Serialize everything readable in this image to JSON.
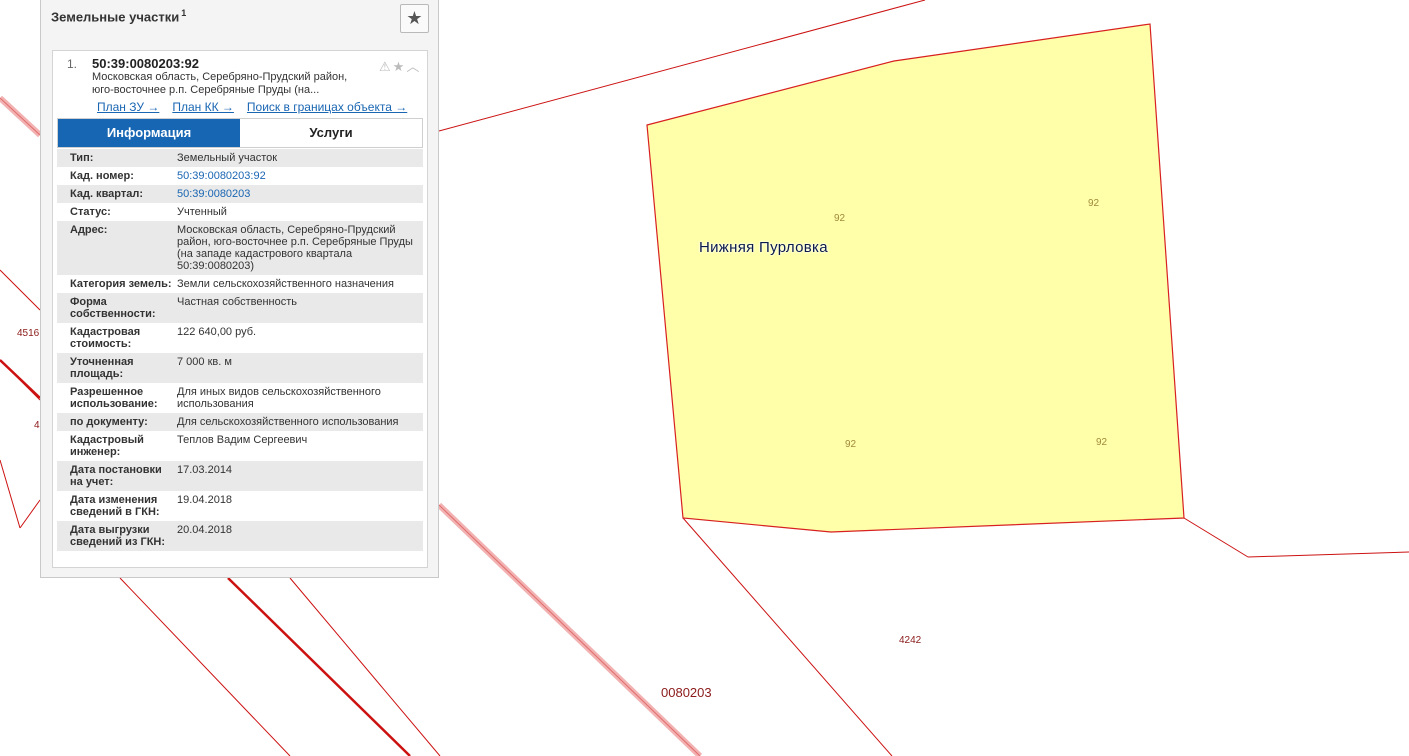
{
  "panel": {
    "title": "Земельные участки",
    "title_count": "1",
    "favorite_icon": "star-icon"
  },
  "result": {
    "index": "1.",
    "cad_number": "50:39:0080203:92",
    "address_short_1": "Московская область, Серебряно-Прудский район,",
    "address_short_2": "юго-восточнее р.п. Серебряные Пруды (на...",
    "icons": [
      "warning-icon",
      "star-icon",
      "chevron-up-icon"
    ],
    "links": {
      "plan_zu": "План ЗУ →",
      "plan_kk": "План КК →",
      "search_bounds": "Поиск в границах объекта →"
    }
  },
  "tabs": {
    "info": "Информация",
    "services": "Услуги"
  },
  "details": [
    {
      "label": "Тип:",
      "value": "Земельный участок"
    },
    {
      "label": "Кад. номер:",
      "value": "50:39:0080203:92"
    },
    {
      "label": "Кад. квартал:",
      "value": "50:39:0080203"
    },
    {
      "label": "Статус:",
      "value": "Учтенный"
    },
    {
      "label": "Адрес:",
      "value": "Московская область, Серебряно-Прудский район, юго-восточнее р.п. Серебряные Пруды (на западе кадастрового квартала 50:39:0080203)"
    },
    {
      "label": "Категория земель:",
      "value": "Земли сельскохозяйственного назначения"
    },
    {
      "label": "Форма собственности:",
      "value": "Частная собственность"
    },
    {
      "label": "Кадастровая стоимость:",
      "value": "122 640,00 руб."
    },
    {
      "label": "Уточненная площадь:",
      "value": "7 000 кв. м"
    },
    {
      "label": "Разрешенное использование:",
      "value": "Для иных видов сельскохозяйственного использования"
    },
    {
      "label": "по документу:",
      "value": "Для сельскохозяйственного использования"
    },
    {
      "label": "Кадастровый инженер:",
      "value": "Теплов Вадим Сергеевич"
    },
    {
      "label": "Дата постановки на учет:",
      "value": "17.03.2014"
    },
    {
      "label": "Дата изменения сведений в ГКН:",
      "value": "19.04.2018"
    },
    {
      "label": "Дата выгрузки сведений из ГКН:",
      "value": "20.04.2018"
    }
  ],
  "map": {
    "place_name": "Нижняя Пурловка",
    "plot_labels": [
      "92",
      "92",
      "92",
      "92"
    ],
    "parcel_labels": [
      "4516",
      "4",
      "4242"
    ],
    "quarter_label": "0080203",
    "colors": {
      "plot_fill": "#ffffaa",
      "boundary": "#cc1111",
      "accent": "#1766b3"
    }
  }
}
